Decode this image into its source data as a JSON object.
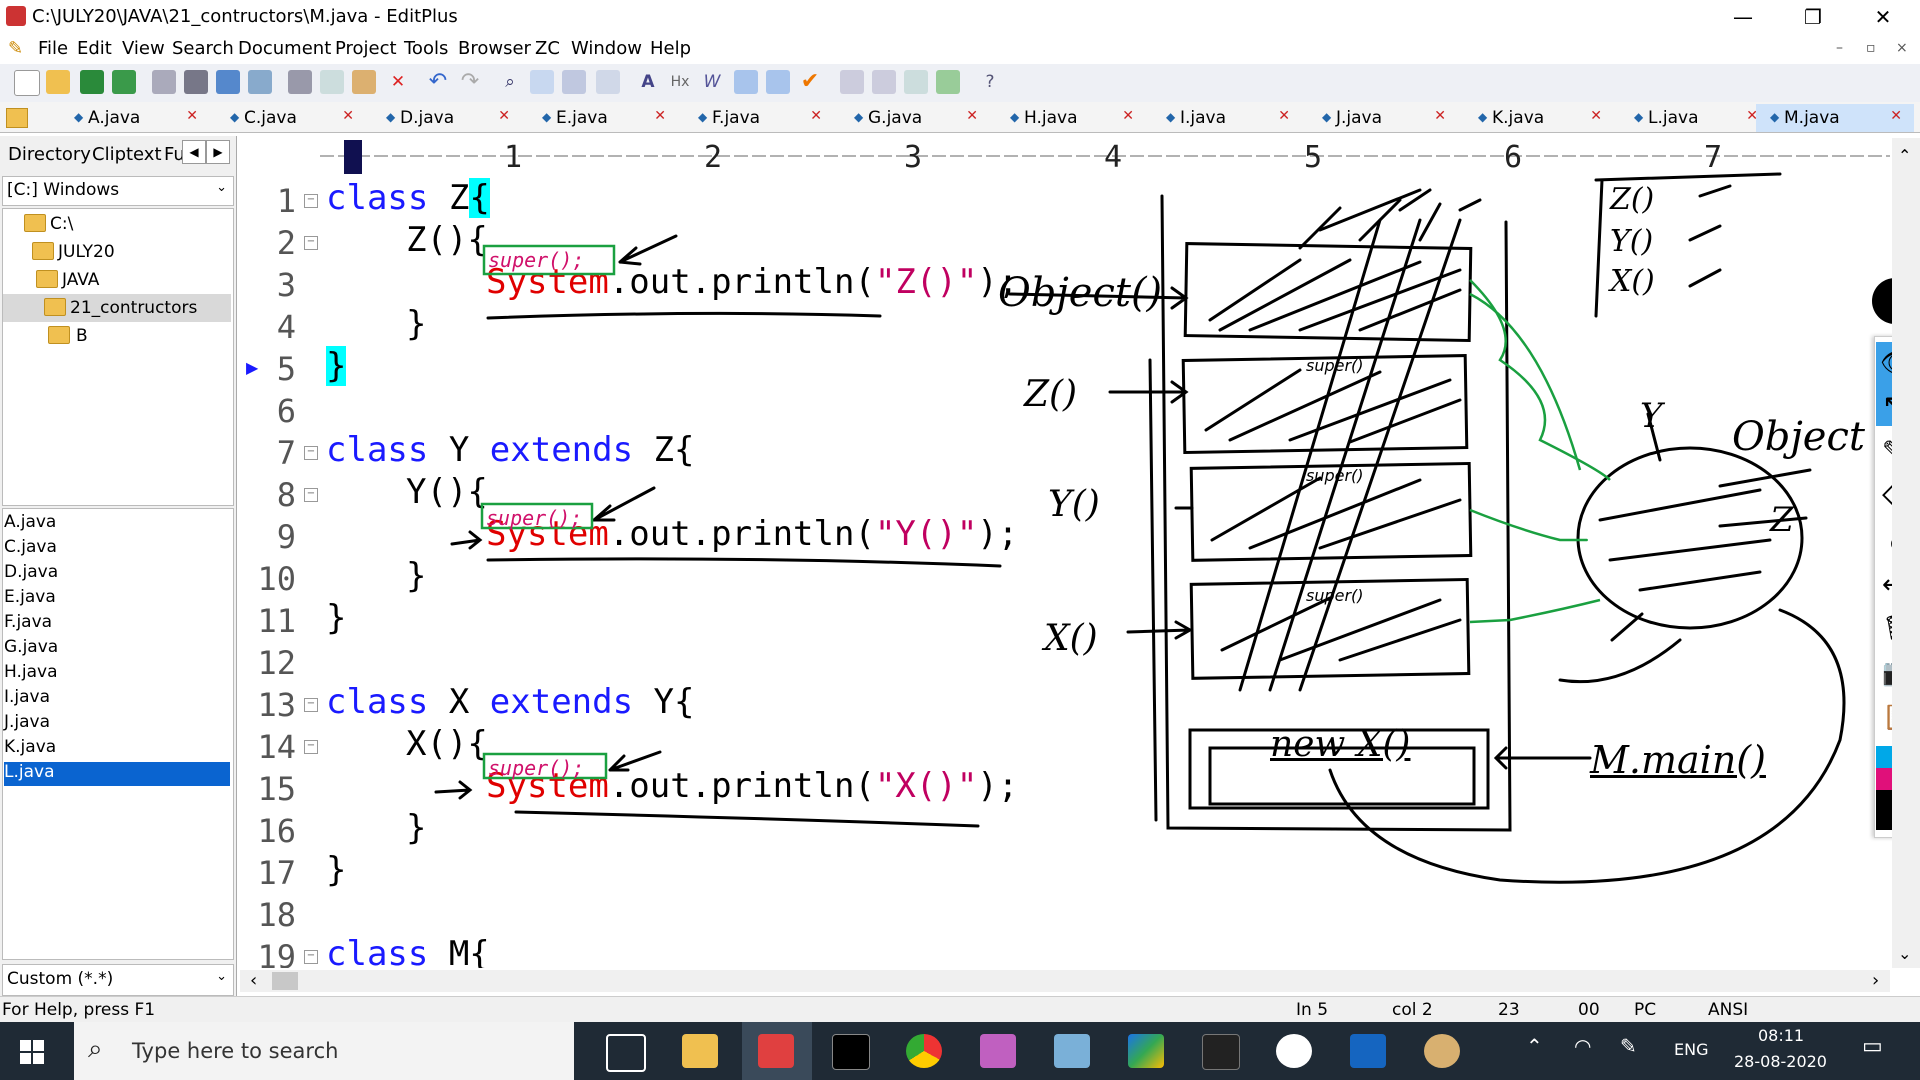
{
  "window": {
    "title": "C:\\JULY20\\JAVA\\21_contructors\\M.java - EditPlus",
    "minimize": "—",
    "restore": "❐",
    "close": "✕"
  },
  "menu": [
    "File",
    "Edit",
    "View",
    "Search",
    "Document",
    "Project",
    "Tools",
    "Browser",
    "ZC",
    "Window",
    "Help"
  ],
  "tabs": [
    "A.java",
    "C.java",
    "D.java",
    "E.java",
    "F.java",
    "G.java",
    "H.java",
    "I.java",
    "J.java",
    "K.java",
    "L.java",
    "M.java"
  ],
  "active_tab": "M.java",
  "left_panel": {
    "tabs": [
      "Directory",
      "Cliptext",
      "Fu"
    ],
    "drive": "[C:] Windows",
    "tree": [
      "C:\\",
      "JULY20",
      "JAVA",
      "21_contructors",
      "B"
    ],
    "files": [
      "A.java",
      "C.java",
      "D.java",
      "E.java",
      "F.java",
      "G.java",
      "H.java",
      "I.java",
      "J.java",
      "K.java",
      "L.java"
    ],
    "selected_file": "L.java",
    "filter": "Custom (*.*)"
  },
  "ruler": [
    "1",
    "2",
    "3",
    "4",
    "5",
    "6",
    "7"
  ],
  "code_lines": [
    {
      "n": "1",
      "text": "class Z{"
    },
    {
      "n": "2",
      "text": "Z(){"
    },
    {
      "n": "3",
      "text": "System.out.println(\"Z()\");"
    },
    {
      "n": "4",
      "text": "}"
    },
    {
      "n": "5",
      "text": "}"
    },
    {
      "n": "6",
      "text": ""
    },
    {
      "n": "7",
      "text": "class Y extends Z{"
    },
    {
      "n": "8",
      "text": "Y(){"
    },
    {
      "n": "9",
      "text": "System.out.println(\"Y()\");"
    },
    {
      "n": "10",
      "text": "}"
    },
    {
      "n": "11",
      "text": "}"
    },
    {
      "n": "12",
      "text": ""
    },
    {
      "n": "13",
      "text": "class X extends Y{"
    },
    {
      "n": "14",
      "text": "X(){"
    },
    {
      "n": "15",
      "text": "System.out.println(\"X()\");"
    },
    {
      "n": "16",
      "text": "}"
    },
    {
      "n": "17",
      "text": "}"
    },
    {
      "n": "18",
      "text": ""
    },
    {
      "n": "19",
      "text": "class M{"
    }
  ],
  "annotations": {
    "super": "super();",
    "object_label": "Object()",
    "z_label": "Z()",
    "y_label": "Y()",
    "x_label": "X()",
    "new_x": "new X()",
    "main": "M.main()",
    "obj_word": "Object",
    "y_small": "Y",
    "z_small": "Z",
    "list": [
      "Z()",
      "Y()",
      "X()"
    ],
    "super_small": "super()"
  },
  "status": {
    "help": "For Help, press F1",
    "ln": "In 5",
    "col": "col 2",
    "n23": "23",
    "n00": "00",
    "pc": "PC",
    "enc": "ANSI"
  },
  "taskbar": {
    "search_placeholder": "Type here to search",
    "lang": "ENG",
    "time": "08:11",
    "date": "28-08-2020"
  }
}
